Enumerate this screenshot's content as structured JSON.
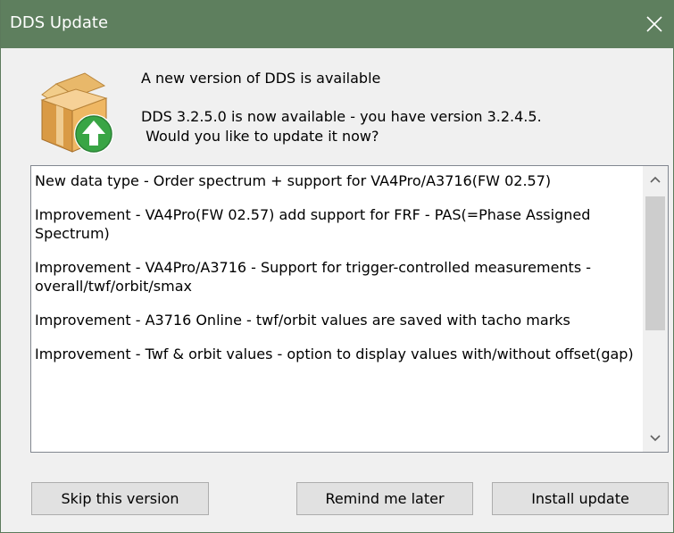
{
  "window": {
    "title": "DDS Update"
  },
  "header": {
    "heading": "A new version of DDS is available",
    "message_line1": "DDS 3.2.5.0 is now available - you have version 3.2.4.5.",
    "message_line2": " Would you like to update it now?"
  },
  "release_notes": [
    "New data type - Order spectrum + support for VA4Pro/A3716(FW 02.57)",
    "Improvement - VA4Pro(FW 02.57) add support for FRF - PAS(=Phase Assigned Spectrum)",
    "Improvement - VA4Pro/A3716 - Support for trigger-controlled measurements - overall/twf/orbit/smax",
    "Improvement - A3716 Online - twf/orbit values are saved with tacho marks",
    "Improvement - Twf & orbit values - option to display values with/without offset(gap)"
  ],
  "buttons": {
    "skip": "Skip this version",
    "remind": "Remind me later",
    "install": "Install update"
  },
  "icons": {
    "close": "close-icon",
    "package": "package-update-icon",
    "scroll_up": "chevron-up-icon",
    "scroll_down": "chevron-down-icon"
  },
  "colors": {
    "titlebar": "#5e7f5e",
    "update_arrow": "#39a545"
  }
}
